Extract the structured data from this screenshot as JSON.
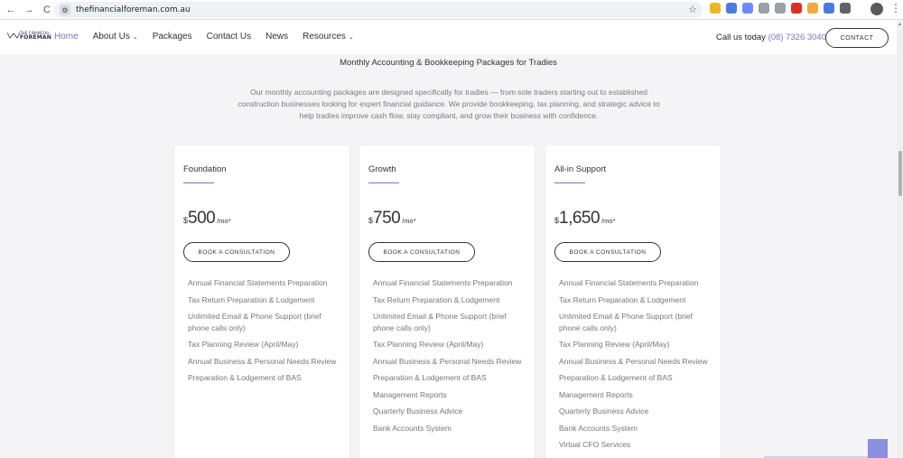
{
  "browser": {
    "url": "thefinancialforeman.com.au",
    "back": "←",
    "forward": "→",
    "reload": "C"
  },
  "header": {
    "logo_text_line1": "THE FINANCIAL",
    "logo_text_line2": "FOREMAN",
    "nav": [
      {
        "label": "Home",
        "active": true
      },
      {
        "label": "About Us",
        "caret": "⌄"
      },
      {
        "label": "Packages"
      },
      {
        "label": "Contact Us"
      },
      {
        "label": "News"
      },
      {
        "label": "Resources",
        "caret": "⌄"
      }
    ],
    "call_label": "Call us today",
    "phone": "(08) 7326 3040",
    "contact_button": "CONTACT"
  },
  "page": {
    "title": "Monthly Accounting & Bookkeeping Packages for Tradies",
    "intro": "Our monthly accounting packages are designed specifically for tradies — from sole traders starting out to established construction businesses looking for expert financial guidance. We provide bookkeeping, tax planning, and strategic advice to help tradies improve cash flow, stay compliant, and grow their business with confidence."
  },
  "plans": [
    {
      "name": "Foundation",
      "currency": "$",
      "amount": "500",
      "per": "/mo*",
      "button": "BOOK A CONSULTATION",
      "features": [
        "Annual Financial Statements Preparation",
        "Tax Return Preparation & Lodgement",
        "Unlimited Email & Phone Support (brief phone calls only)",
        "Tax Planning Review (April/May)",
        "Annual Business & Personal Needs Review",
        "Preparation & Lodgement of BAS"
      ]
    },
    {
      "name": "Growth",
      "currency": "$",
      "amount": "750",
      "per": "/mo*",
      "button": "BOOK A CONSULTATION",
      "features": [
        "Annual Financial Statements Preparation",
        "Tax Return Preparation & Lodgement",
        "Unlimited Email & Phone Support (brief phone calls only)",
        "Tax Planning Review (April/May)",
        "Annual Business & Personal Needs Review",
        "Preparation & Lodgement of BAS",
        "Management Reports",
        "Quarterly Business Advice",
        "Bank Accounts System"
      ]
    },
    {
      "name": "All-in Support",
      "currency": "$",
      "amount": "1,650",
      "per": "/mo*",
      "button": "BOOK A CONSULTATION",
      "features": [
        "Annual Financial Statements Preparation",
        "Tax Return Preparation & Lodgement",
        "Unlimited Email & Phone Support (brief phone calls only)",
        "Tax Planning Review (April/May)",
        "Annual Business & Personal Needs Review",
        "Preparation & Lodgement of BAS",
        "Management Reports",
        "Quarterly Business Advice",
        "Bank Accounts System",
        "Virtual CFO Services"
      ]
    }
  ],
  "colors": {
    "accent": "#7b72c9",
    "background": "#f4f4f6"
  },
  "icons": {
    "star": "bookmark-star-icon",
    "site": "site-info-icon"
  }
}
